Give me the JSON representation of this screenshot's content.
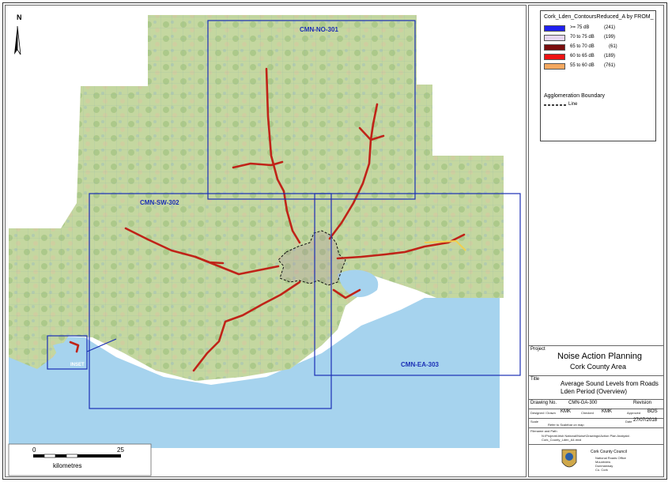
{
  "map": {
    "north_label": "N",
    "sheets": [
      {
        "id": "CMN-NO-301"
      },
      {
        "id": "CMN-SW-302"
      },
      {
        "id": "CMN-EA-303"
      }
    ],
    "inset_label": "INSET",
    "scalebar": {
      "start": "0",
      "end": "25",
      "unit": "kilometres"
    }
  },
  "legend": {
    "title": "Cork_Lden_ContoursReduced_A by FROM_",
    "items": [
      {
        "label": ">= 75  dB",
        "count": "(241)",
        "color": "#1f1ff0"
      },
      {
        "label": "70 to 75 dB",
        "count": "(199)",
        "color": "#e6d6f0"
      },
      {
        "label": "65 to 70 dB",
        "count": "(61)",
        "color": "#7a0d0d"
      },
      {
        "label": "60 to 65 dB",
        "count": "(189)",
        "color": "#ee1212"
      },
      {
        "label": "55 to 60 dB",
        "count": "(761)",
        "color": "#f4a860"
      }
    ],
    "boundary_heading": "Agglomeration Boundary",
    "boundary_label": "Line"
  },
  "title_block": {
    "project_label": "Project",
    "project_title": "Noise Action Planning",
    "project_subtitle": "Cork County Area",
    "title_label": "Title",
    "title_line1": "Average Sound Levels from Roads",
    "title_line2": "Lden Period (Overview)",
    "drawing_no_label": "Drawing No.",
    "drawing_no": "CMN-GA-300",
    "revision_label": "Revision",
    "designed_label": "Designed / Drawn",
    "designed_value": "KMK",
    "checked_label": "Checked",
    "checked_value": "KMK",
    "approved_label": "Approved",
    "approved_value": "BOS",
    "scale_label": "Scale",
    "scale_value": "Refer to Scalebar on map",
    "date_label": "Date",
    "date_value": "27/07/2018",
    "filename_label": "Filename and Path",
    "filepath": "N:\\Projects\\Irish National\\Noise\\Drawings\\Action Plan Analysis\\",
    "filename": "Cork_County_Lden_A4.mxd",
    "council": "Cork County Council",
    "office_lines": [
      "National Roads Office",
      "Mountview",
      "Dunmanway",
      "Co. Cork"
    ]
  },
  "colors": {
    "sea": "#a6d3ee",
    "land": "#bfd39c",
    "sheet_outline": "#1a2fb5",
    "road": "#c02318"
  }
}
